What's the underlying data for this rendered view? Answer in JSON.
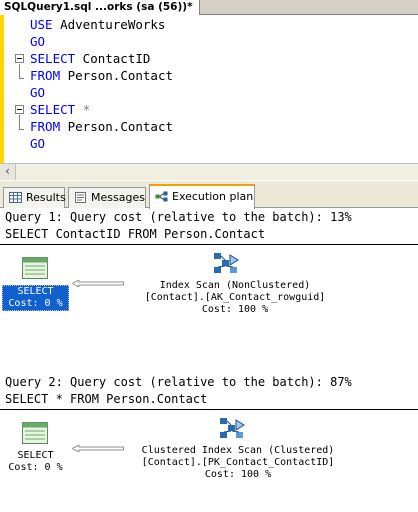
{
  "document_tab": {
    "title": "SQLQuery1.sql ...orks (sa (56))*"
  },
  "editor": {
    "lines": [
      {
        "kw": "USE",
        "rest": " AdventureWorks"
      },
      {
        "kw": "GO",
        "rest": ""
      },
      {
        "kw": "SELECT",
        "rest": " ContactID"
      },
      {
        "kw": "FROM",
        "rest": " Person.Contact"
      },
      {
        "kw": "GO",
        "rest": ""
      },
      {
        "kw": "SELECT",
        "rest": " ",
        "op": "*"
      },
      {
        "kw": "FROM",
        "rest": " Person.Contact"
      },
      {
        "kw": "GO",
        "rest": ""
      }
    ]
  },
  "scrollbar": {
    "left_arrow": "‹"
  },
  "result_tabs": [
    {
      "label": "Results",
      "icon": "grid-icon",
      "active": false
    },
    {
      "label": "Messages",
      "icon": "messages-icon",
      "active": false
    },
    {
      "label": "Execution plan",
      "icon": "execution-plan-icon",
      "active": true
    }
  ],
  "plan": {
    "queries": [
      {
        "header": "Query 1: Query cost (relative to the batch): 13%",
        "statement": "SELECT ContactID FROM Person.Contact",
        "select_node": {
          "name": "SELECT",
          "cost": "Cost: 0 %",
          "selected": true
        },
        "operator_node": {
          "name": "Index Scan (NonClustered)",
          "object": "[Contact].[AK_Contact_rowguid]",
          "cost": "Cost: 100 %"
        }
      },
      {
        "header": "Query 2: Query cost (relative to the batch): 87%",
        "statement": "SELECT * FROM Person.Contact",
        "select_node": {
          "name": "SELECT",
          "cost": "Cost: 0 %",
          "selected": false
        },
        "operator_node": {
          "name": "Clustered Index Scan (Clustered)",
          "object": "[Contact].[PK_Contact_ContactID]",
          "cost": "Cost: 100 %"
        }
      }
    ]
  },
  "colors": {
    "keyword": "#0000ff",
    "selection": "#1060d0",
    "active_tab_accent": "#f5a000",
    "gutter_changed": "#ffd800"
  }
}
